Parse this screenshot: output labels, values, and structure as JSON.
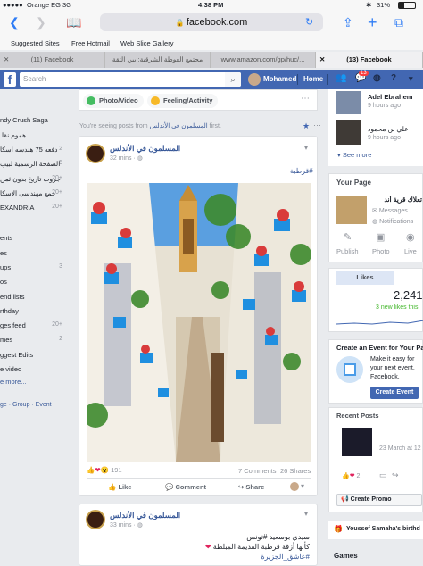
{
  "status_bar": {
    "carrier": "Orange EG",
    "network": "3G",
    "time": "4:38 PM",
    "battery": "31%"
  },
  "safari": {
    "url": "facebook.com"
  },
  "favorites": [
    "Suggested Sites",
    "Free Hotmail",
    "Web Slice Gallery"
  ],
  "tabs": [
    {
      "label": "(11) Facebook"
    },
    {
      "label": "مجتمع الغوطة الشرقية: بين الثقة"
    },
    {
      "label": "www.amazon.com/gp/huc/..."
    },
    {
      "label": "(13) Facebook"
    }
  ],
  "fb_header": {
    "logo": "f",
    "search_placeholder": "Search",
    "user_name": "Mohamed",
    "home_label": "Home",
    "notifications_count": "13"
  },
  "left_menu": [
    {
      "label": "Candy Crush Saga",
      "count": "",
      "visible_text": "ndy Crush Saga"
    },
    {
      "label": "هموم نقا",
      "count": ""
    },
    {
      "label": "دفعه 75 هندسه اسكا",
      "count": "2"
    },
    {
      "label": "الصفحة الرسمية لبيب",
      "count": "5"
    },
    {
      "label": "جروب تاريخ بدون ثمن",
      "count": "20+"
    },
    {
      "label": "جمع مهندسي الاسكا",
      "count": "20+"
    },
    {
      "label": "EXANDRIA",
      "count": "20+"
    },
    {
      "label": "ents",
      "count": ""
    },
    {
      "label": "es",
      "count": ""
    },
    {
      "label": "ups",
      "count": "3"
    },
    {
      "label": "os",
      "count": ""
    },
    {
      "label": "end lists",
      "count": ""
    },
    {
      "label": "rthday",
      "count": ""
    },
    {
      "label": "ges feed",
      "count": "20+"
    },
    {
      "label": "mes",
      "count": "2"
    },
    {
      "label": "ggest Edits",
      "count": ""
    },
    {
      "label": "e video",
      "count": ""
    },
    {
      "label": "e more...",
      "count": ""
    }
  ],
  "left_footer": "ge · Group · Event",
  "composer": {
    "photo_video": "Photo/Video",
    "feeling_activity": "Feeling/Activity"
  },
  "seeing_posts": {
    "prefix": "You're seeing posts from",
    "page": "المسلمون في الأندلس",
    "suffix": "first."
  },
  "post1": {
    "author": "المسلمون في الأندلس",
    "time": "32 mins",
    "hashtag": "#قرطبة",
    "reactions_count": "191",
    "comments": "7 Comments",
    "shares": "26 Shares",
    "like": "Like",
    "comment": "Comment",
    "share": "Share"
  },
  "post2": {
    "author": "المسلمون في الأندلس",
    "time": "33 mins",
    "line1": "سيدي بوسعيد #تونس",
    "line2": "كأنها أزقة قرطبة القديمة المبلطة",
    "line3": "#عاشق_الجزيرة"
  },
  "right_col": {
    "friends": [
      {
        "name": "Adel Ebrahem",
        "time": "9 hours ago"
      },
      {
        "name": "علي بن محمود",
        "time": "9 hours ago"
      }
    ],
    "see_more": "See more",
    "your_page": {
      "title": "Your Page",
      "page_name": "تعلاك قرية أند",
      "messages": "Messages",
      "notifications": "Notifications",
      "actions": [
        "Publish",
        "Photo",
        "Live"
      ],
      "likes_tab": "Likes",
      "likes_count": "2,241",
      "new_likes": "3 new likes this"
    },
    "create_event": {
      "title": "Create an Event for Your Pa",
      "text1": "Make it easy for",
      "text2": "your next event.",
      "text3": "Facebook.",
      "button": "Create Event"
    },
    "recent_posts": {
      "title": "Recent Posts",
      "date": "23 March at 12",
      "count": "2",
      "create_promo": "Create Promo"
    },
    "birthday": "Youssef Samaha's birthd",
    "games": "Games"
  },
  "colors": {
    "fb_blue": "#4267b2",
    "link": "#385898"
  }
}
